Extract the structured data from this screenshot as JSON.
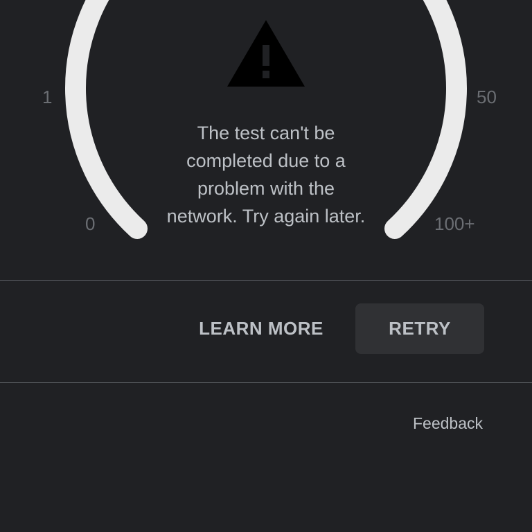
{
  "gauge": {
    "scale_labels": {
      "top_left": "1",
      "top_right": "50",
      "bottom_left": "0",
      "bottom_right": "100+"
    },
    "icon": "warning-icon",
    "arc_color": "#ebebeb"
  },
  "error": {
    "lines": [
      "The test can't be",
      "completed due to a",
      "problem with the",
      "network. Try again later."
    ]
  },
  "actions": {
    "learn_more_label": "LEARN MORE",
    "retry_label": "RETRY"
  },
  "footer": {
    "feedback_label": "Feedback"
  },
  "colors": {
    "background": "#202124",
    "text": "#bdc1c6",
    "muted": "#6b6e73",
    "button_bg": "#303134",
    "divider": "#5f6368"
  }
}
